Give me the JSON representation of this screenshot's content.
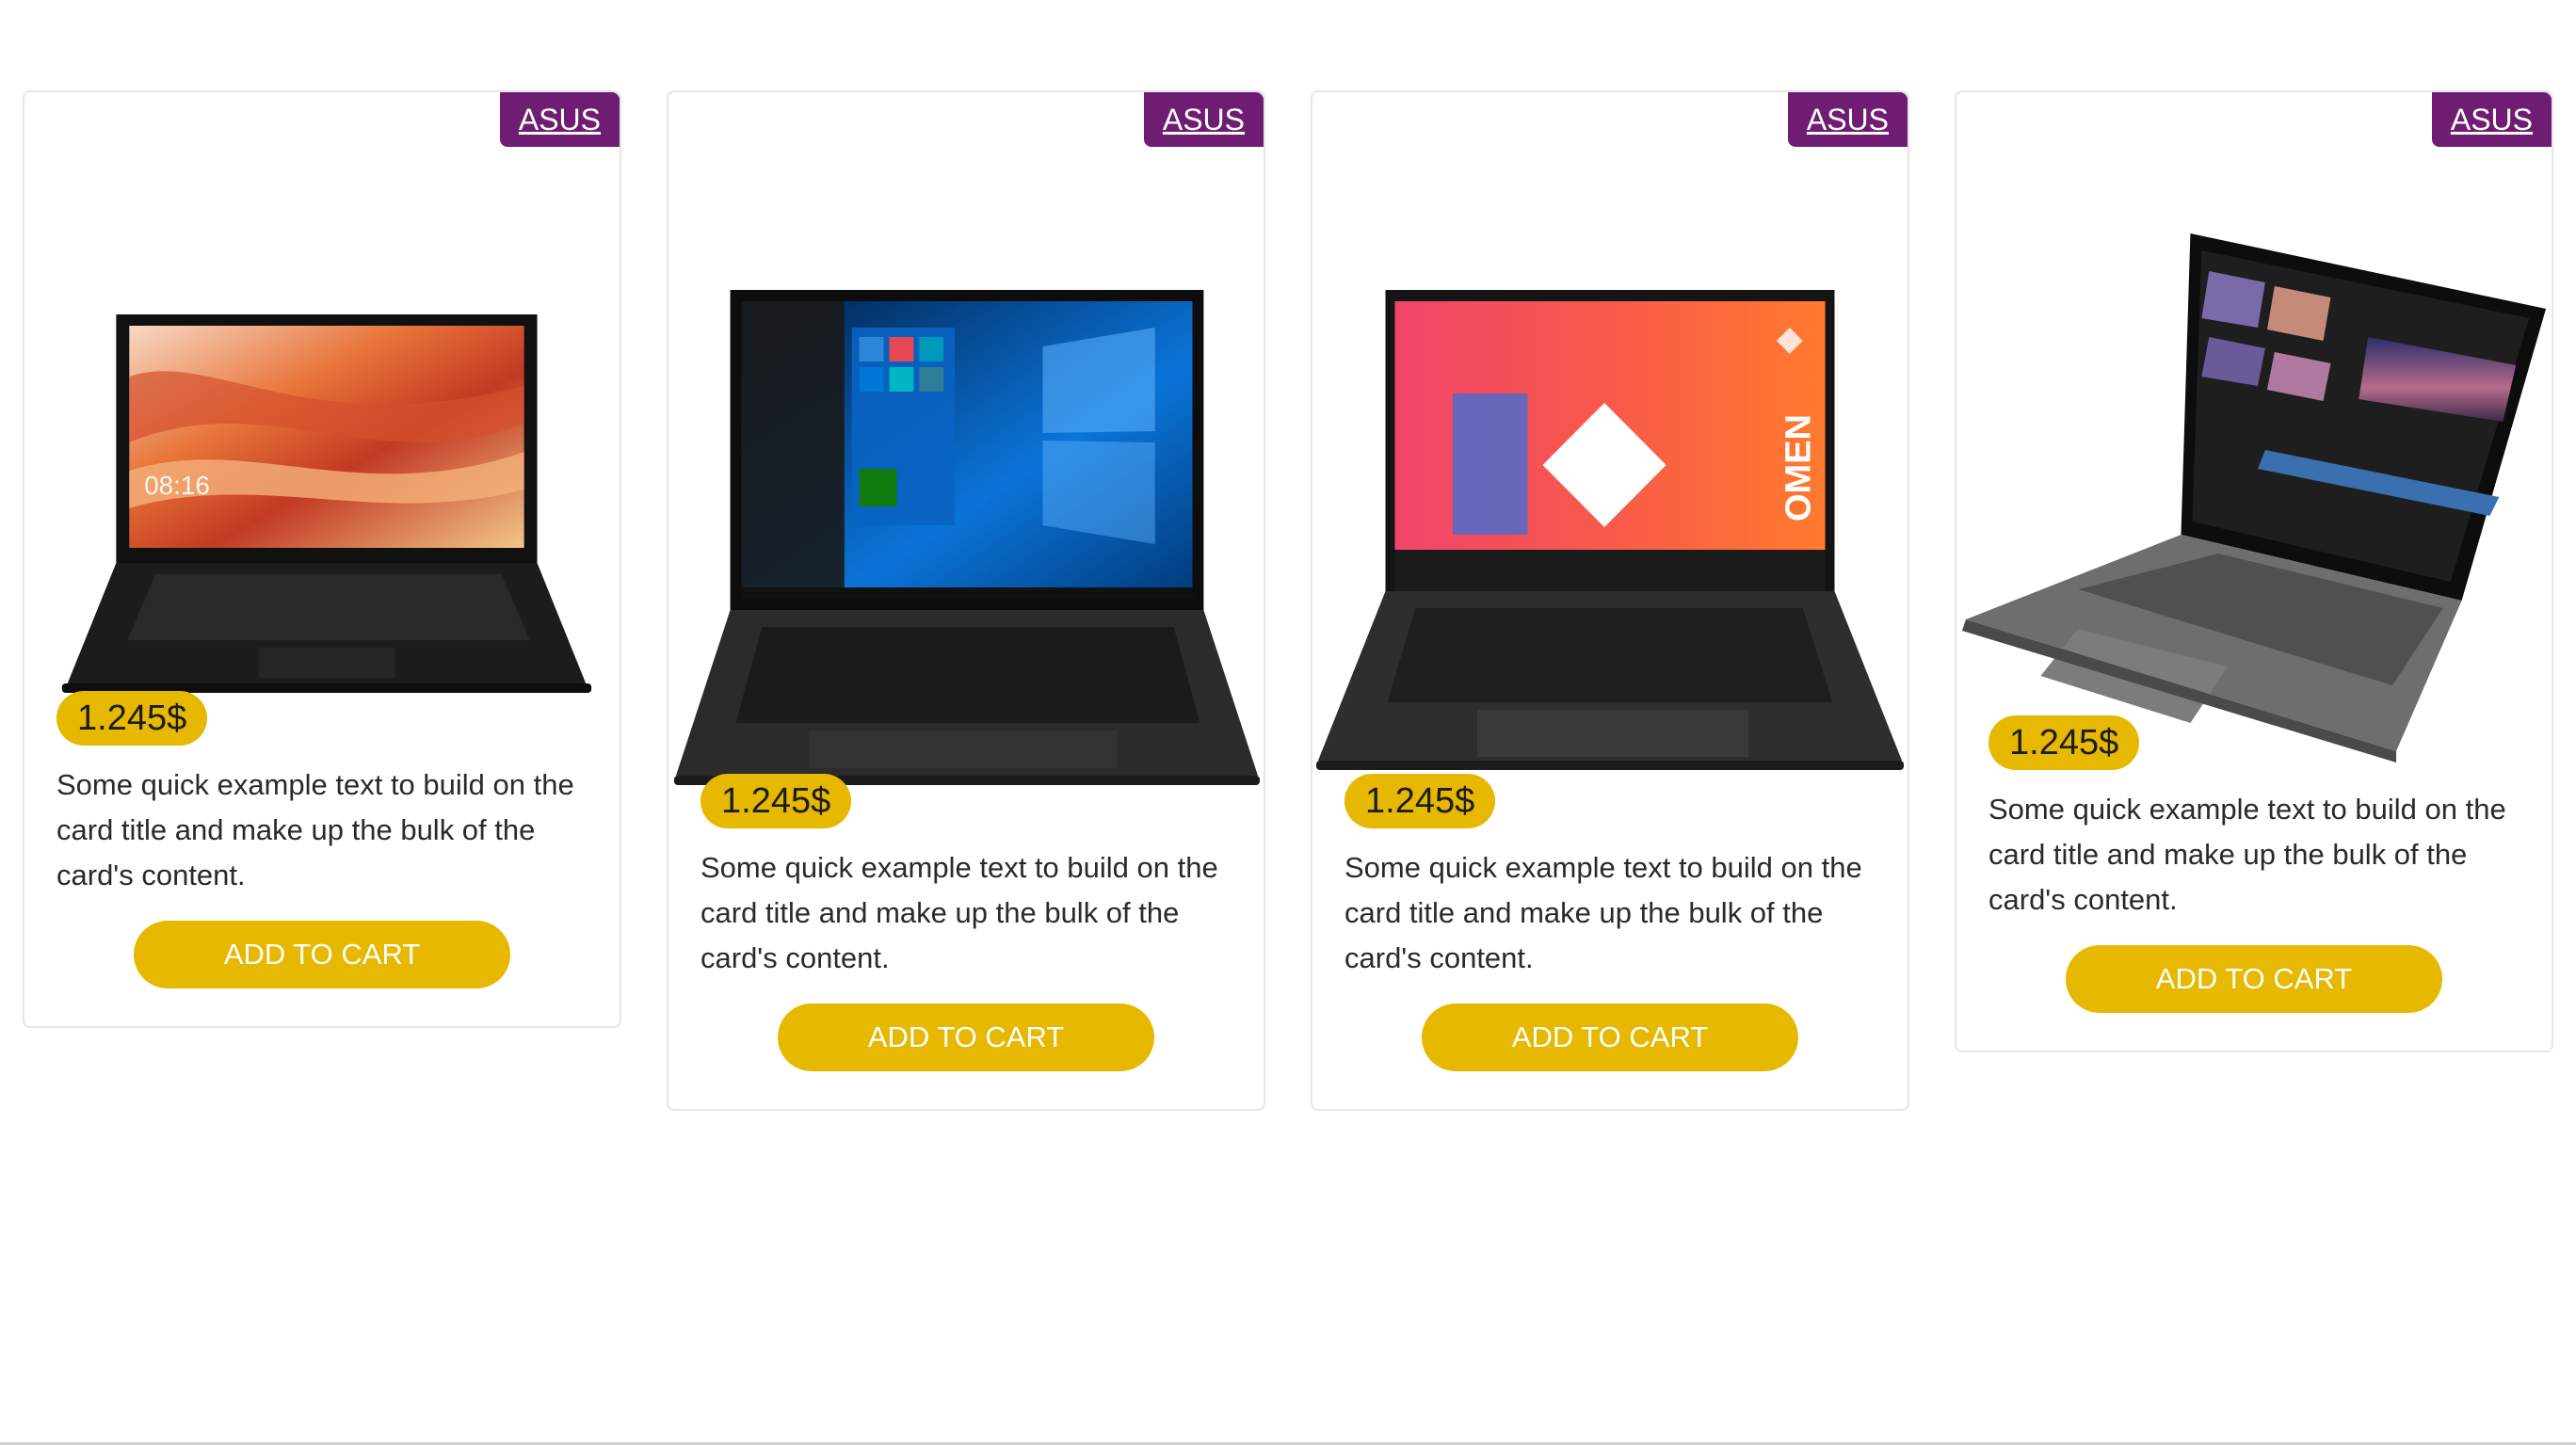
{
  "products": [
    {
      "brand": "ASUS",
      "price": "1.245$",
      "description": "Some quick example text to build on the card title and make up the bulk of the card's content.",
      "button_label": "ADD TO CART"
    },
    {
      "brand": "ASUS",
      "price": "1.245$",
      "description": "Some quick example text to build on the card title and make up the bulk of the card's content.",
      "button_label": "ADD TO CART"
    },
    {
      "brand": "ASUS",
      "price": "1.245$",
      "description": "Some quick example text to build on the card title and make up the bulk of the card's content.",
      "button_label": "ADD TO CART"
    },
    {
      "brand": "ASUS",
      "price": "1.245$",
      "description": "Some quick example text to build on the card title and make up the bulk of the card's content.",
      "button_label": "ADD TO CART"
    }
  ],
  "screen_text": {
    "laptop_1_clock": "08:16",
    "laptop_3_logo": "OMEN"
  },
  "colors": {
    "brand_tag": "#6f1d72",
    "accent_yellow": "#e6b800"
  }
}
